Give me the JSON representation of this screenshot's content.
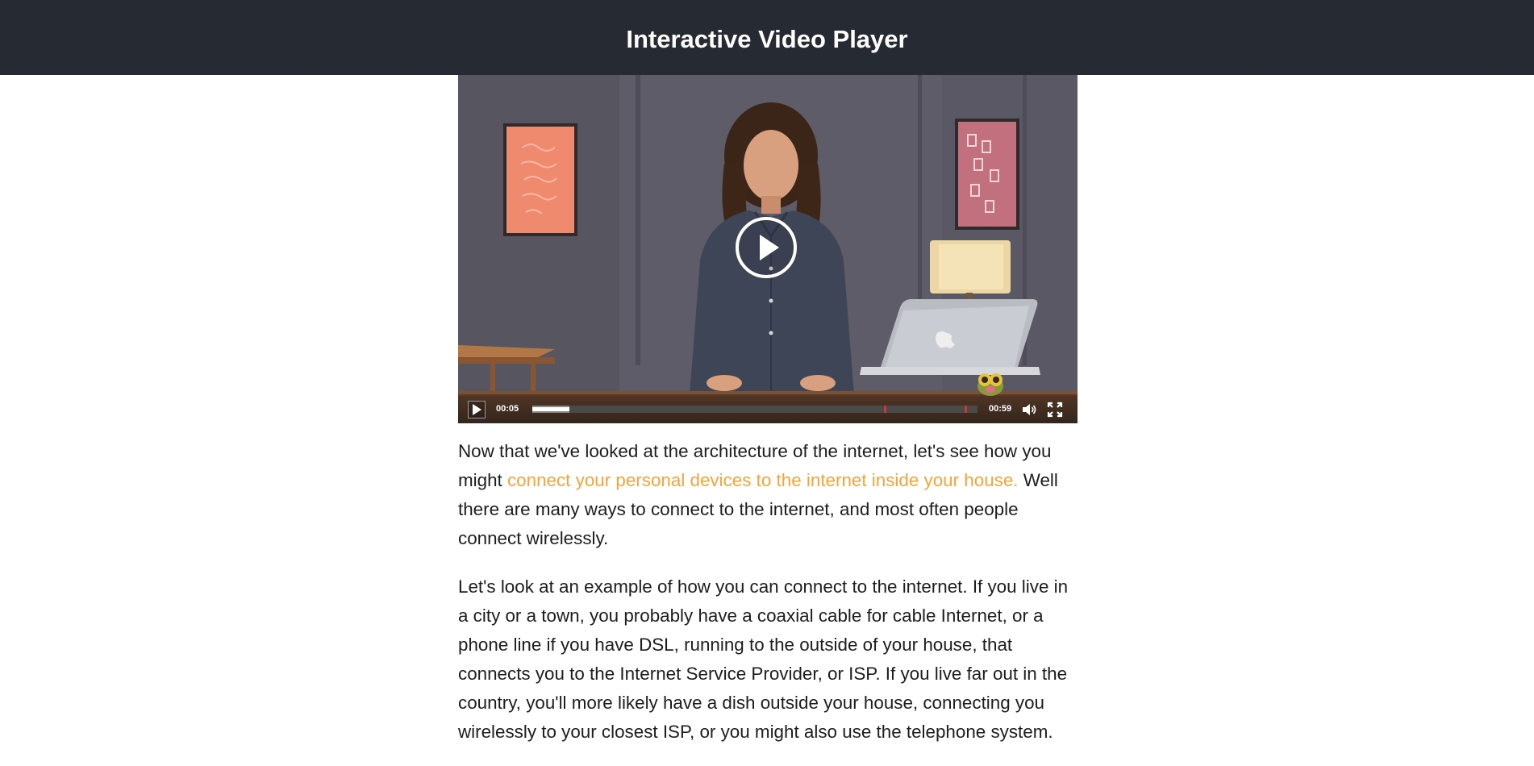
{
  "header": {
    "title": "Interactive Video Player"
  },
  "player": {
    "current_time": "00:05",
    "duration": "00:59",
    "played_fraction": 0.083,
    "loaded_fraction": 0.083,
    "big_play_icon": "play-circle-icon",
    "control_icons": [
      "play-icon",
      "volume-icon",
      "fullscreen-icon"
    ]
  },
  "transcript": {
    "p1_before": "Now that we've looked at the architecture of the internet, let's see how you might ",
    "p1_link": "connect your personal devices to the internet inside your house.",
    "p1_after": "  Well there are many ways to connect to the internet, and most often people connect wirelessly.",
    "p2": "Let's look at an example of how you can connect to the internet.  If you live in a city or a town, you probably have a coaxial cable for cable Internet, or a phone line if you have DSL, running to the outside of your house, that connects you to the Internet Service Provider, or ISP.  If you live far out in the country, you'll more likely have a dish outside your house, connecting you wirelessly to your closest ISP, or you might also use the telephone system."
  },
  "colors": {
    "header_bg": "#262a32",
    "highlight_link": "#f6a43a",
    "body_text": "#1d1d1d"
  }
}
